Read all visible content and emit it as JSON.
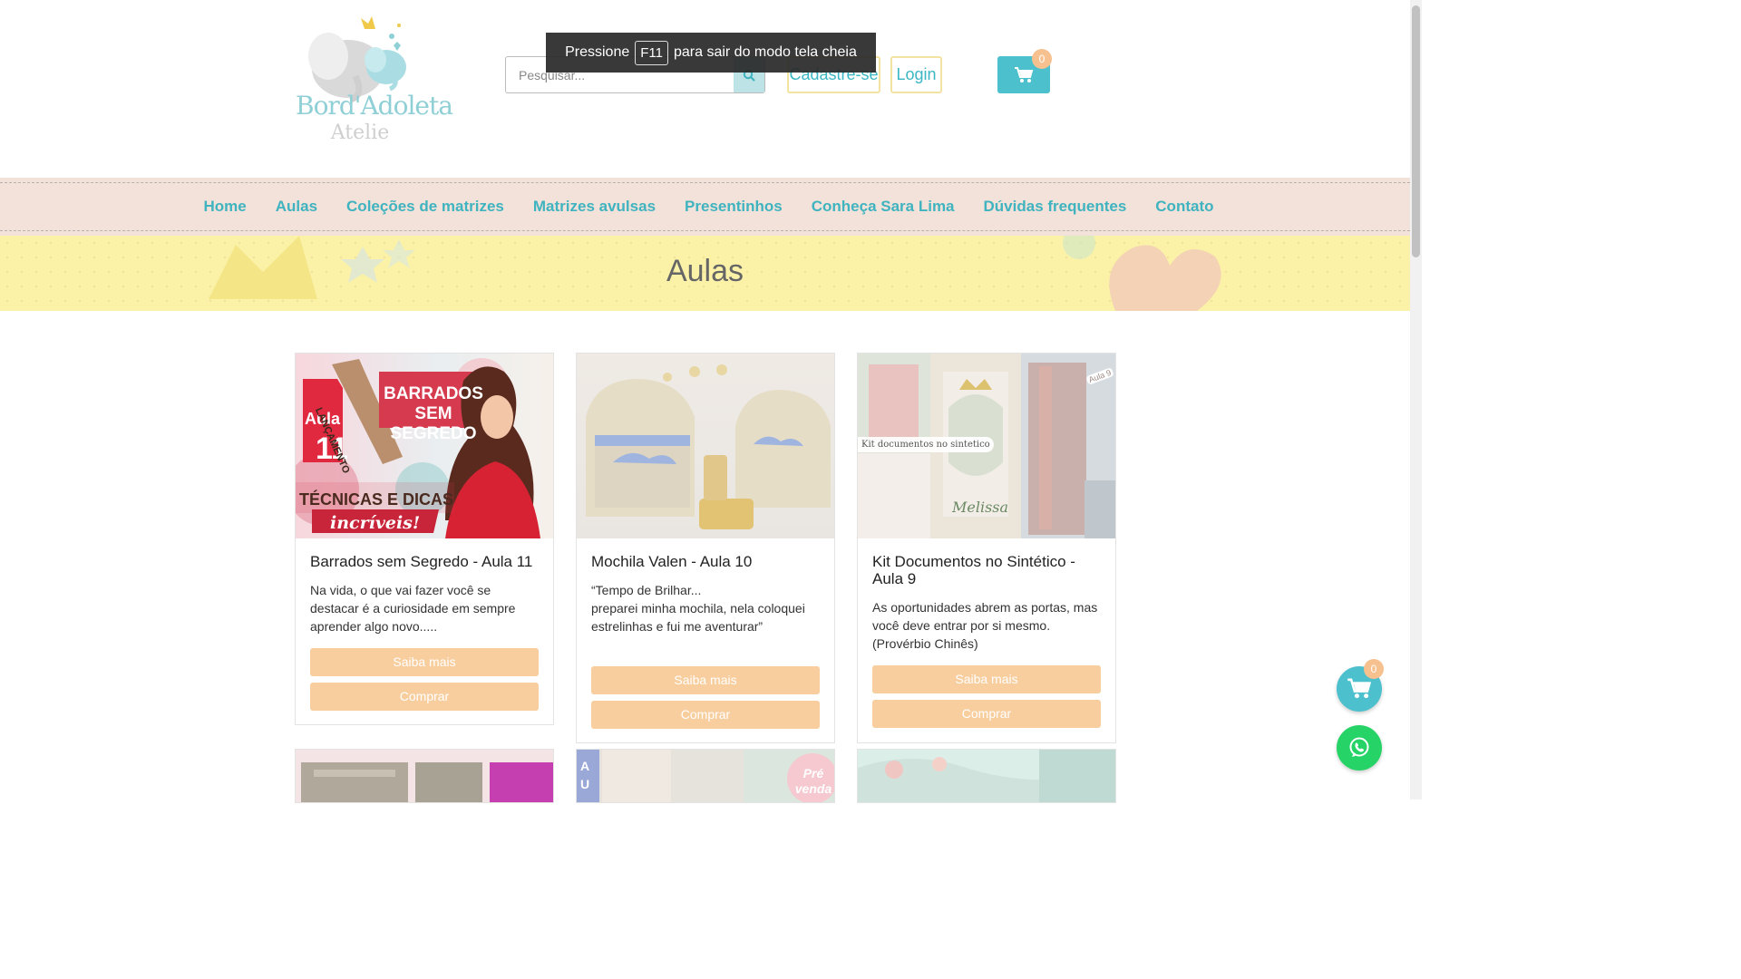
{
  "header": {
    "logo_line1": "Bord'Adoleta",
    "logo_line2": "Atelie",
    "search_placeholder": "Pesquisar...",
    "signup_label": "Cadastre-se",
    "login_label": "Login",
    "cart_count": "0"
  },
  "fullscreen_toast": {
    "before": "Pressione",
    "key": "F11",
    "after": "para sair do modo tela cheia"
  },
  "nav": {
    "items": [
      {
        "label": "Home"
      },
      {
        "label": "Aulas"
      },
      {
        "label": "Coleções de matrizes"
      },
      {
        "label": "Matrizes avulsas"
      },
      {
        "label": "Presentinhos"
      },
      {
        "label": "Conheça Sara Lima"
      },
      {
        "label": "Dúvidas frequentes"
      },
      {
        "label": "Contato"
      }
    ]
  },
  "banner": {
    "title": "Aulas"
  },
  "cards": [
    {
      "title": "Barrados sem Segredo - Aula 11",
      "description": "Na vida, o que vai fazer você se destacar é a curiosidade em sempre aprender algo novo.....",
      "more_label": "Saiba mais",
      "buy_label": "Comprar",
      "image_text": {
        "tag_aula": "Aula",
        "tag_num": "11",
        "ribbon": "LANÇAMENTO",
        "heading1": "BARRADOS SEM",
        "heading2": "SEGREDO",
        "tech": "TÉCNICAS E DICAS",
        "script": "incríveis!"
      }
    },
    {
      "title": "Mochila Valen - Aula 10",
      "description": "“Tempo de Brilhar...\npreparei minha mochila, nela coloquei estrelinhas e fui me aventurar”",
      "more_label": "Saiba mais",
      "buy_label": "Comprar"
    },
    {
      "title": "Kit Documentos no Sintético - Aula 9",
      "description": "As oportunidades abrem as portas, mas você deve entrar por si mesmo. (Provérbio Chinês)",
      "more_label": "Saiba mais",
      "buy_label": "Comprar",
      "image_text": {
        "caption": "Kit documentos no sintetico",
        "name": "Melissa",
        "tag": "Aula 9"
      }
    }
  ],
  "next_row": {
    "col2_letters": "A U",
    "col2_badge": "Pré venda"
  },
  "floating": {
    "cart_count": "0"
  },
  "colors": {
    "accent": "#3fb3bf",
    "cart": "#4cc1cd",
    "button": "#f8ce9e",
    "nav_bg": "#f3e2d9",
    "banner_bg": "#fbf2a8",
    "whatsapp": "#25d366"
  }
}
